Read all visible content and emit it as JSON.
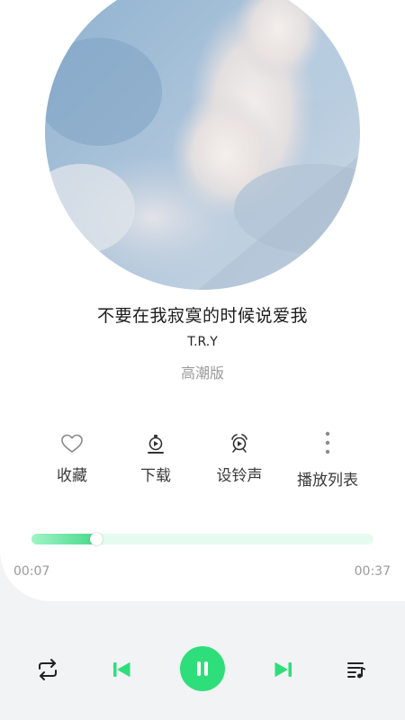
{
  "song": {
    "title": "不要在我寂寞的时候说爱我",
    "artist": "T.R.Y",
    "version": "高潮版"
  },
  "actions": {
    "favorite": {
      "label": "收藏",
      "icon": "heart-icon"
    },
    "download": {
      "label": "下载",
      "icon": "download-icon"
    },
    "ringtone": {
      "label": "设铃声",
      "icon": "alarm-bell-icon"
    },
    "playlist": {
      "label": "播放列表",
      "icon": "more-vertical-icon"
    }
  },
  "progress": {
    "current_time": "00:07",
    "total_time": "00:37",
    "fraction": 0.19
  },
  "controls": {
    "repeat": "repeat-icon",
    "previous": "skip-previous-icon",
    "play_pause": "pause-icon",
    "next": "skip-next-icon",
    "queue": "queue-music-icon"
  },
  "colors": {
    "accent": "#2ede7a",
    "progress_track": "#e6fbef",
    "progress_fill_start": "#9ff5c5",
    "progress_fill_end": "#4ad88c",
    "secondary_text": "#9a9a9a"
  }
}
